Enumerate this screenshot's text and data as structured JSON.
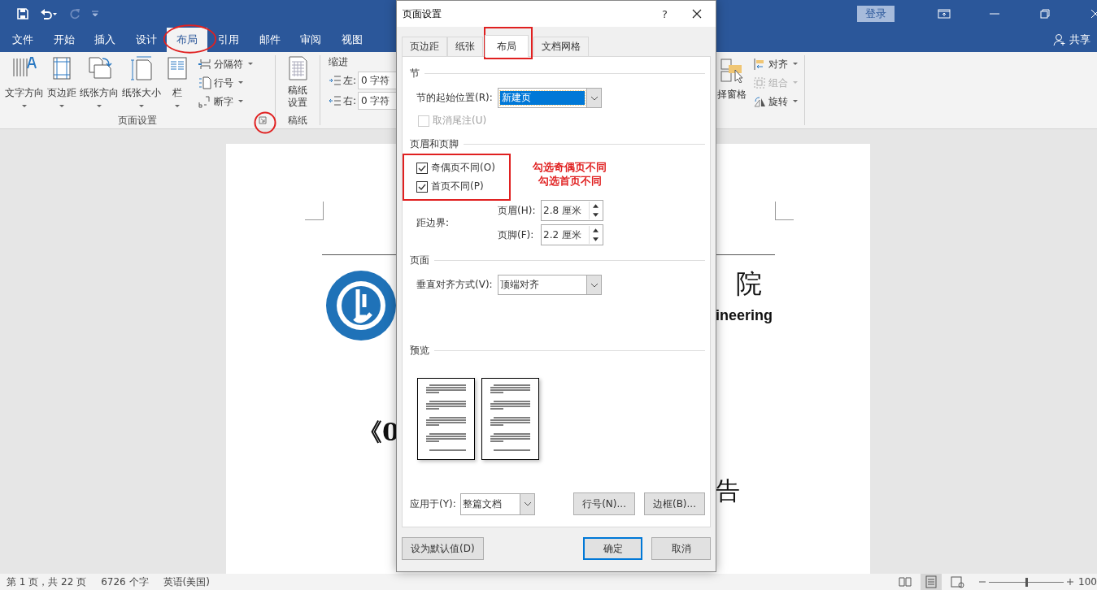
{
  "window": {
    "sign_in": "登录",
    "share": "共享"
  },
  "ribbon_tabs": [
    {
      "label": "文件",
      "selected": false
    },
    {
      "label": "开始",
      "selected": false
    },
    {
      "label": "插入",
      "selected": false
    },
    {
      "label": "设计",
      "selected": false
    },
    {
      "label": "布局",
      "selected": true
    },
    {
      "label": "引用",
      "selected": false
    },
    {
      "label": "邮件",
      "selected": false
    },
    {
      "label": "审阅",
      "selected": false
    },
    {
      "label": "视图",
      "selected": false
    }
  ],
  "ribbon": {
    "page_setup": {
      "large_buttons": [
        {
          "label": "文字方向",
          "kind": "text-direction"
        },
        {
          "label": "页边距",
          "kind": "margins"
        },
        {
          "label": "纸张方向",
          "kind": "orientation"
        },
        {
          "label": "纸张大小",
          "kind": "size"
        },
        {
          "label": "栏",
          "kind": "columns"
        }
      ],
      "small_buttons": [
        {
          "label": "分隔符",
          "kind": "breaks"
        },
        {
          "label": "行号",
          "kind": "line-numbers"
        },
        {
          "label": "断字",
          "kind": "hyphenation"
        }
      ],
      "group_label": "页面设置"
    },
    "draft": {
      "button": "稿纸设置",
      "group_label": "稿纸"
    },
    "indent": {
      "title": "缩进",
      "fields": [
        {
          "label": "左:",
          "value": "0 字符",
          "kind": "left"
        },
        {
          "label": "右:",
          "value": "0 字符",
          "kind": "right"
        }
      ]
    },
    "arrange": {
      "selection_pane": "择窗格",
      "buttons": [
        {
          "label": "对齐",
          "disabled": false,
          "kind": "align"
        },
        {
          "label": "组合",
          "disabled": true,
          "kind": "group"
        },
        {
          "label": "旋转",
          "disabled": false,
          "kind": "rotate"
        }
      ]
    }
  },
  "document": {
    "title_end": "院",
    "subtitle_end": "ineering",
    "heading_start": "《0",
    "heading_end": "告"
  },
  "dialog": {
    "title": "页面设置",
    "help": "?",
    "tabs": [
      {
        "label": "页边距",
        "selected": false
      },
      {
        "label": "纸张",
        "selected": false
      },
      {
        "label": "布局",
        "selected": true
      },
      {
        "label": "文档网格",
        "selected": false
      }
    ],
    "section": {
      "heading": "节",
      "start_label": "节的起始位置(R):",
      "start_value": "新建页",
      "suppress_endnotes": {
        "label": "取消尾注(U)",
        "checked": false,
        "disabled": true
      }
    },
    "headers_footers": {
      "heading": "页眉和页脚",
      "options": [
        {
          "label": "奇偶页不同(O)",
          "checked": true
        },
        {
          "label": "首页不同(P)",
          "checked": true
        }
      ],
      "from_edge_label": "距边界:",
      "distances": [
        {
          "label": "页眉(H):",
          "value": "2.8 厘米"
        },
        {
          "label": "页脚(F):",
          "value": "2.2 厘米"
        }
      ]
    },
    "page": {
      "heading": "页面",
      "valign_label": "垂直对齐方式(V):",
      "valign_value": "顶端对齐"
    },
    "preview": {
      "heading": "预览"
    },
    "apply_label": "应用于(Y):",
    "apply_value": "整篇文档",
    "line_numbers_button": "行号(N)...",
    "borders_button": "边框(B)...",
    "buttons": [
      {
        "label": "设为默认值(D)",
        "default": false
      },
      {
        "label": "确定",
        "default": true
      },
      {
        "label": "取消",
        "default": false
      }
    ],
    "annotation": [
      "勾选奇偶页不同",
      "勾选首页不同"
    ]
  },
  "status_bar": {
    "page": "第 1 页，共 22 页",
    "words": "6726 个字",
    "language": "英语(美国)",
    "views": [
      {
        "kind": "read",
        "selected": false
      },
      {
        "kind": "print",
        "selected": true
      },
      {
        "kind": "web",
        "selected": false
      }
    ],
    "zoom_slider": {
      "level": 0.5
    },
    "zoom": "100"
  }
}
